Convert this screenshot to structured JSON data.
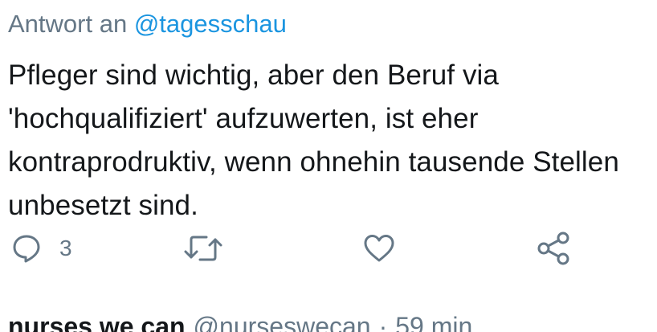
{
  "reply": {
    "prefix": "Antwort an",
    "handle": "@tagesschau"
  },
  "tweet": {
    "text": "Pfleger sind wichtig, aber den Beruf via\n'hochqualifiziert' aufzuwerten, ist eher\nkontraprodruktiv, wenn ohnehin tausende Stellen\nunbesetzt sind."
  },
  "actions": {
    "reply_count": "3",
    "reply_icon": "reply-icon",
    "retweet_icon": "retweet-icon",
    "like_icon": "heart-icon",
    "share_icon": "share-icon"
  },
  "next_tweet": {
    "name": "nurses we can",
    "handle": "@nurseswecan",
    "separator": "·",
    "time": "59 min"
  },
  "colors": {
    "accent": "#1b95e0",
    "secondary_text": "#657786",
    "primary_text": "#14171a"
  }
}
